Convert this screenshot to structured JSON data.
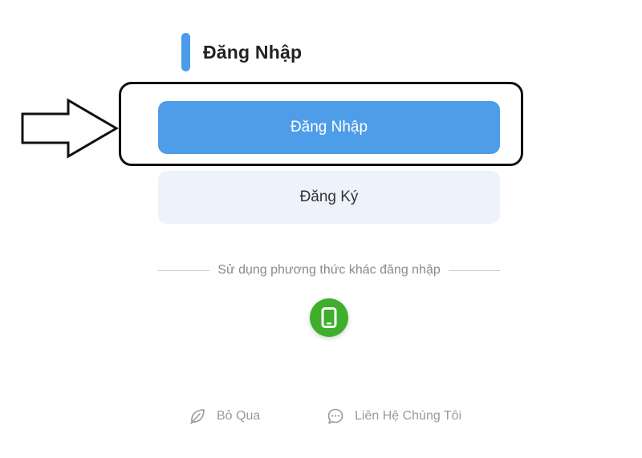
{
  "header": {
    "title": "Đăng Nhập",
    "accent_color": "#4a9be8"
  },
  "buttons": {
    "login_label": "Đăng Nhập",
    "register_label": "Đăng Ký",
    "login_color": "#4e9de8",
    "register_color": "#eef2fa"
  },
  "divider": {
    "text": "Sử dụng phương thức khác đăng nhập"
  },
  "alt_login": {
    "icon": "phone-icon",
    "color": "#3fae2a"
  },
  "footer": {
    "skip_label": "Bỏ Qua",
    "skip_icon": "leaf-icon",
    "contact_label": "Liên Hệ Chúng Tôi",
    "contact_icon": "chat-bubble-icon"
  },
  "annotation": {
    "arrow_icon": "pointer-arrow-icon",
    "highlight_color": "#111111"
  }
}
